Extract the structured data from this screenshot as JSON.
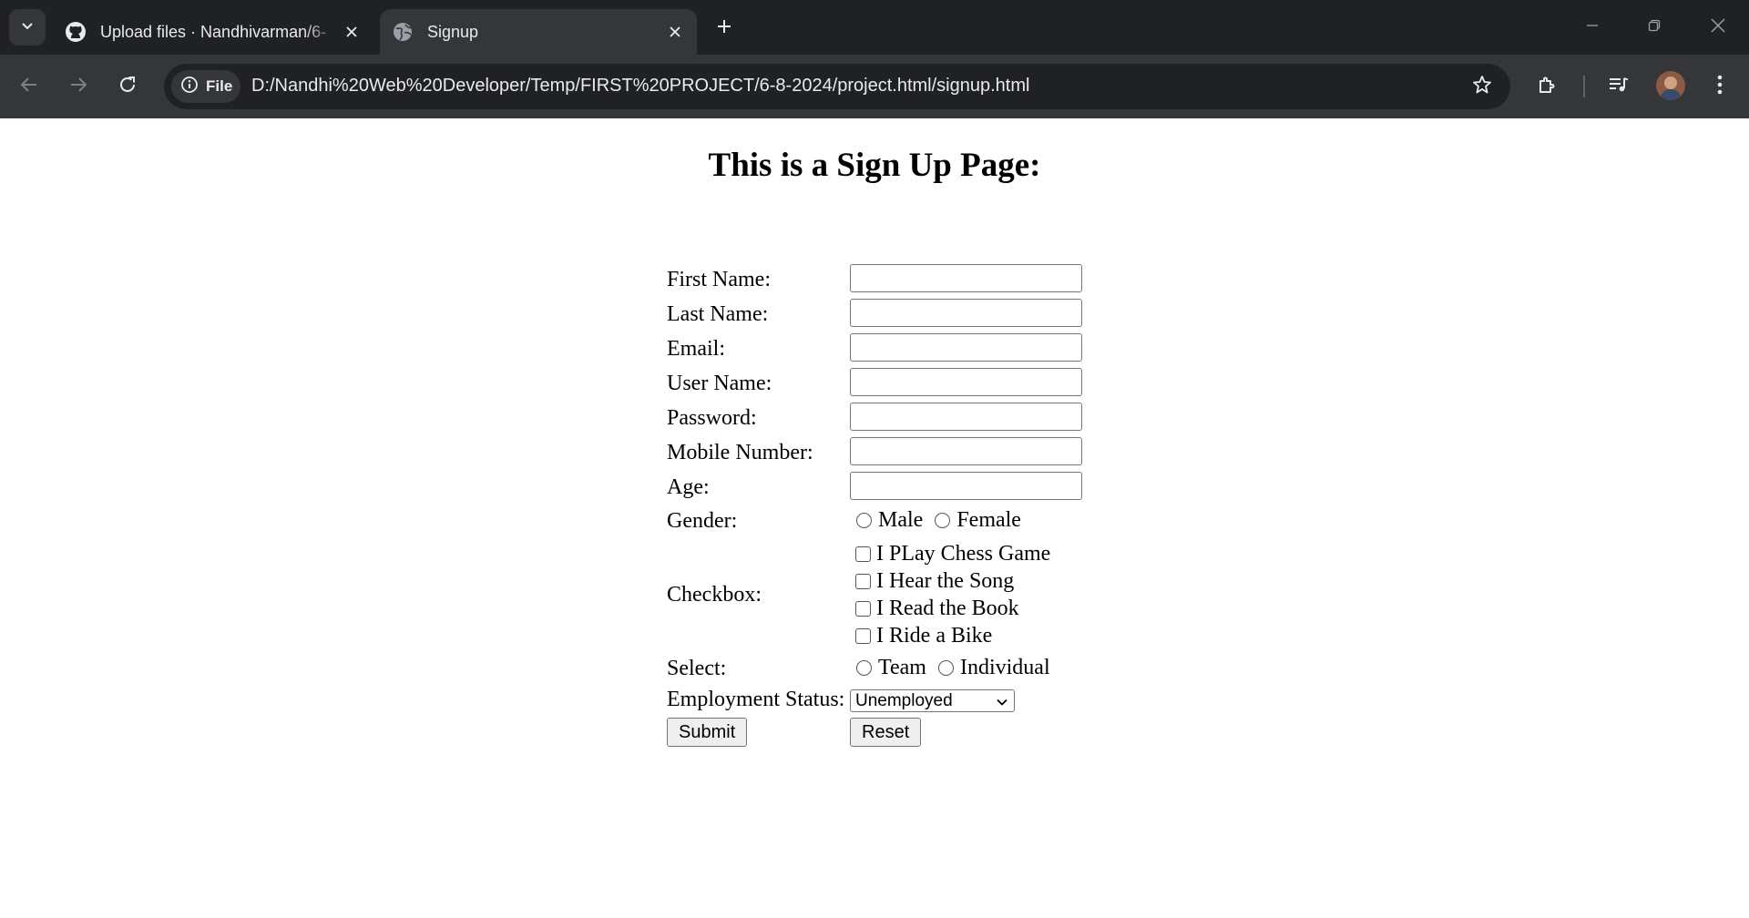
{
  "browser": {
    "tabs": [
      {
        "title": "Upload files · Nandhivarman/6-",
        "icon": "github-icon",
        "active": false
      },
      {
        "title": "Signup",
        "icon": "globe-icon",
        "active": true
      }
    ],
    "omnibox": {
      "chip_label": "File",
      "url": "D:/Nandhi%20Web%20Developer/Temp/FIRST%20PROJECT/6-8-2024/project.html/signup.html"
    }
  },
  "page": {
    "heading": "This is a Sign Up Page:",
    "form": {
      "first_name_label": "First Name:",
      "last_name_label": "Last Name:",
      "email_label": "Email:",
      "username_label": "User Name:",
      "password_label": "Password:",
      "mobile_label": "Mobile Number:",
      "age_label": "Age:",
      "gender_label": "Gender:",
      "gender_options": [
        "Male",
        "Female"
      ],
      "checkbox_label": "Checkbox:",
      "checkbox_options": [
        "I PLay Chess Game",
        "I Hear the Song",
        "I Read the Book",
        "I Ride a Bike"
      ],
      "select_label": "Select:",
      "select_options": [
        "Team",
        "Individual"
      ],
      "employment_label": "Employment Status:",
      "employment_value": "Unemployed",
      "submit_label": "Submit",
      "reset_label": "Reset"
    }
  },
  "colors": {
    "chrome_dark": "#202124",
    "chrome_toolbar": "#35363a",
    "chrome_text": "#e8eaed",
    "page_bg": "#ffffff"
  }
}
